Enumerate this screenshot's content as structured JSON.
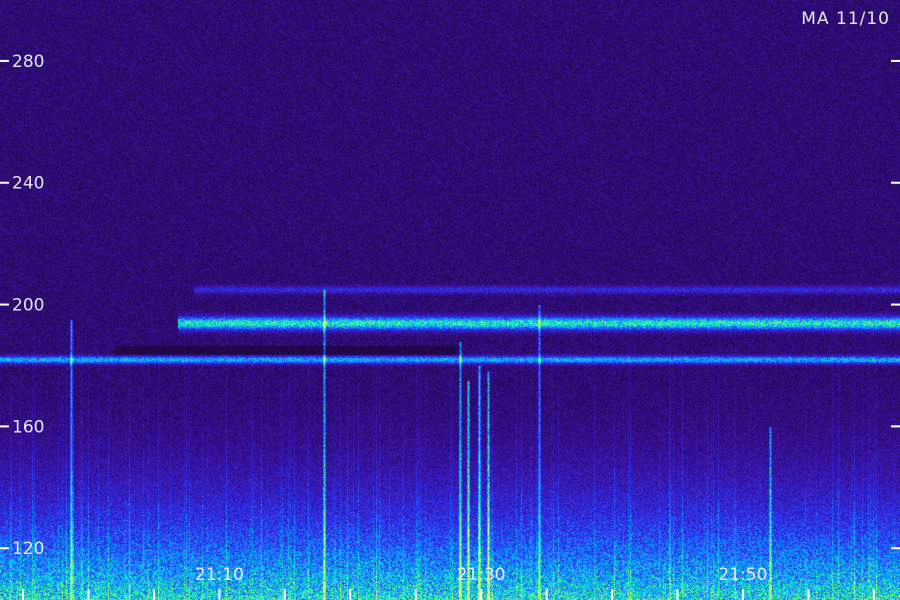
{
  "chart_data": {
    "type": "heatmap",
    "title": "",
    "stamp": "MA 11/10",
    "xlabel": "",
    "ylabel": "",
    "ylim": [
      103,
      300
    ],
    "yticks": [
      120,
      160,
      200,
      240,
      280
    ],
    "ytick_labels": [
      "120",
      "160",
      "200",
      "240",
      "280"
    ],
    "xlim": [
      21.027,
      21.6
    ],
    "xtick_labels": [
      {
        "value": 21.1667,
        "label": "21:10"
      },
      {
        "value": 21.3333,
        "label": "21:30"
      },
      {
        "value": 21.5,
        "label": "21:50"
      }
    ],
    "minor_xticks": [
      21.0417,
      21.0833,
      21.125,
      21.1667,
      21.2083,
      21.25,
      21.2917,
      21.3333,
      21.375,
      21.4167,
      21.4583,
      21.5,
      21.5417,
      21.5833
    ],
    "colormap": [
      "#1a0630",
      "#3a10a0",
      "#2a3cff",
      "#00c8ff",
      "#40ff80",
      "#ffff60"
    ],
    "features": {
      "bands": [
        {
          "y": 194,
          "width": 5,
          "start": 21.14,
          "end": 21.6,
          "intensity": 0.65
        },
        {
          "y": 182,
          "width": 3,
          "start": 21.027,
          "end": 21.6,
          "intensity": 0.5
        },
        {
          "y": 205,
          "width": 3,
          "start": 21.15,
          "end": 21.6,
          "intensity": 0.22
        }
      ],
      "dark_band": {
        "y": 185,
        "width": 3,
        "start": 21.1,
        "end": 21.32
      },
      "noise_floor_top": 128,
      "bright_streaks": [
        {
          "x": 21.072,
          "ytop": 195,
          "intensity": 0.55
        },
        {
          "x": 21.233,
          "ytop": 205,
          "intensity": 0.6
        },
        {
          "x": 21.32,
          "ytop": 188,
          "intensity": 0.55
        },
        {
          "x": 21.325,
          "ytop": 175,
          "intensity": 0.7
        },
        {
          "x": 21.332,
          "ytop": 180,
          "intensity": 0.7
        },
        {
          "x": 21.338,
          "ytop": 178,
          "intensity": 0.65
        },
        {
          "x": 21.37,
          "ytop": 200,
          "intensity": 0.45
        },
        {
          "x": 21.517,
          "ytop": 160,
          "intensity": 0.5
        }
      ]
    }
  }
}
